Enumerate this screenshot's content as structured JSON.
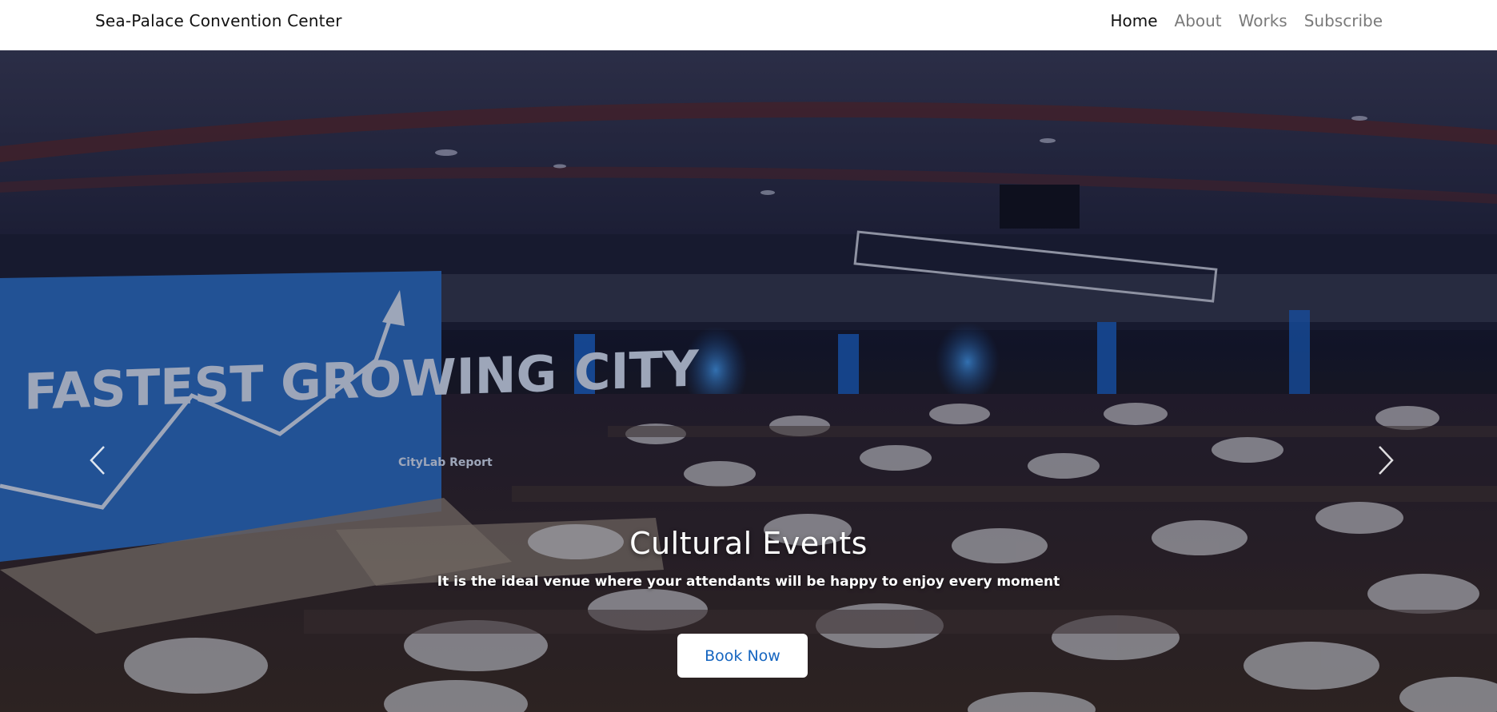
{
  "navbar": {
    "brand": "Sea-Palace Convention Center",
    "links": [
      {
        "label": "Home",
        "active": true
      },
      {
        "label": "About",
        "active": false
      },
      {
        "label": "Works",
        "active": false
      },
      {
        "label": "Subscribe",
        "active": false
      }
    ]
  },
  "hero": {
    "banner_text": "FASTEST GROWING CITY",
    "banner_tag": "CityLab Report",
    "title": "Cultural Events",
    "subtitle": "It is the ideal venue where your attendants will be happy to enjoy every moment",
    "cta_label": "Book Now",
    "prev_icon": "chevron-left-icon",
    "next_icon": "chevron-right-icon"
  },
  "colors": {
    "nav_bg": "#ffffff",
    "nav_active": "#111111",
    "nav_inactive": "#7a7a7a",
    "banner_blue": "#2f6fc4",
    "cta_text": "#1565c0"
  }
}
